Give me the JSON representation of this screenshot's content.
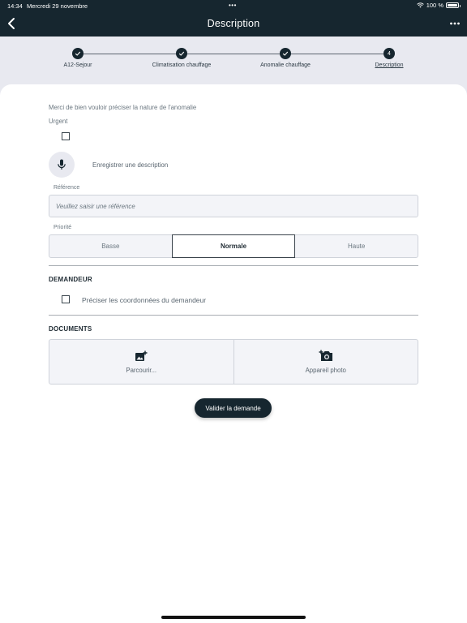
{
  "status_bar": {
    "time": "14:34",
    "date": "Mercredi 29 novembre",
    "dots": "•••",
    "battery_text": "100 %",
    "battery_level": 1.0
  },
  "header": {
    "title": "Description",
    "back_icon": "chevron-left-icon",
    "more_icon": "ellipsis-icon"
  },
  "stepper": {
    "steps": [
      {
        "label": "A12-Sejour",
        "state": "done"
      },
      {
        "label": "Climatisation chauffage",
        "state": "done"
      },
      {
        "label": "Anomalie chauffage",
        "state": "done"
      },
      {
        "label": "Description",
        "state": "current",
        "number": "4"
      }
    ]
  },
  "form": {
    "intro": "Merci de bien vouloir préciser la nature de l'anomalie",
    "urgent_label": "Urgent",
    "urgent_checked": false,
    "record_label": "Enregistrer une description",
    "reference_label": "Référence",
    "reference_placeholder": "Veuillez saisir une référence",
    "reference_value": "",
    "priority_label": "Priorité",
    "priority_options": [
      "Basse",
      "Normale",
      "Haute"
    ],
    "priority_selected": "Normale"
  },
  "requester": {
    "section_title": "DEMANDEUR",
    "checkbox_label": "Préciser les coordonnées du demandeur",
    "checked": false
  },
  "documents": {
    "section_title": "DOCUMENTS",
    "browse_label": "Parcourir...",
    "camera_label": "Appareil photo"
  },
  "submit_label": "Valider la demande",
  "colors": {
    "primary_dark": "#16262f",
    "stepper_bg": "#e8e9f0",
    "field_bg": "#f3f4f8"
  }
}
